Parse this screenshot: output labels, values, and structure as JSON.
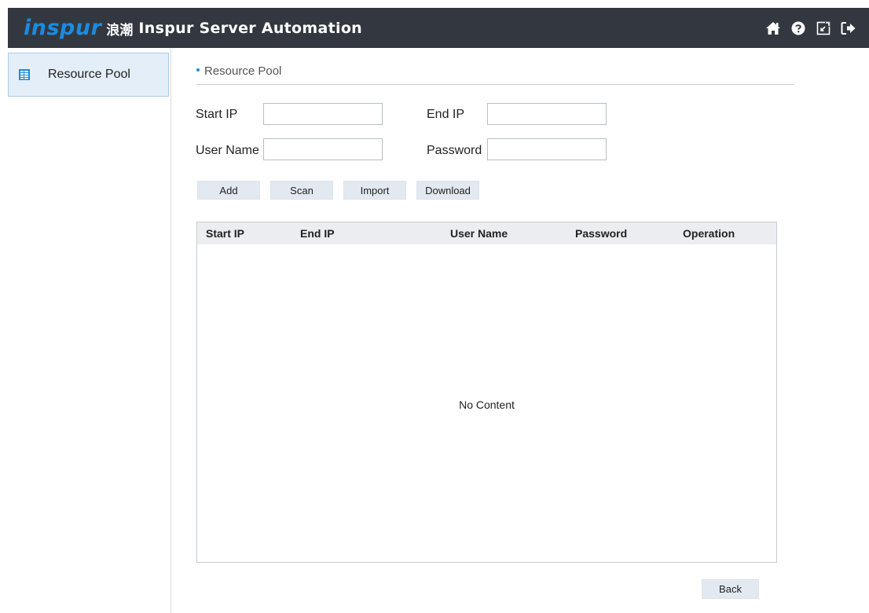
{
  "header": {
    "logo_text": "INSPUR",
    "logo_cn": "浪潮",
    "title": "Inspur Server Automation",
    "icons": [
      "home-icon",
      "help-icon",
      "export-icon",
      "logout-icon"
    ]
  },
  "sidebar": {
    "items": [
      {
        "label": "Resource Pool",
        "icon": "table-icon",
        "active": true
      }
    ]
  },
  "main": {
    "section_title": "Resource Pool",
    "form": {
      "start_ip": {
        "label": "Start IP",
        "value": ""
      },
      "end_ip": {
        "label": "End IP",
        "value": ""
      },
      "user_name": {
        "label": "User Name",
        "value": ""
      },
      "password": {
        "label": "Password",
        "value": ""
      }
    },
    "buttons": {
      "add": "Add",
      "scan": "Scan",
      "import": "Import",
      "download": "Download",
      "back": "Back"
    },
    "table": {
      "columns": [
        "Start IP",
        "End IP",
        "User Name",
        "Password",
        "Operation"
      ],
      "rows": [],
      "empty_text": "No Content"
    }
  },
  "colors": {
    "header_bg": "#333840",
    "brand_blue": "#1a8be0",
    "active_item_bg": "#e3eef8",
    "button_bg": "#e3e9f0"
  }
}
